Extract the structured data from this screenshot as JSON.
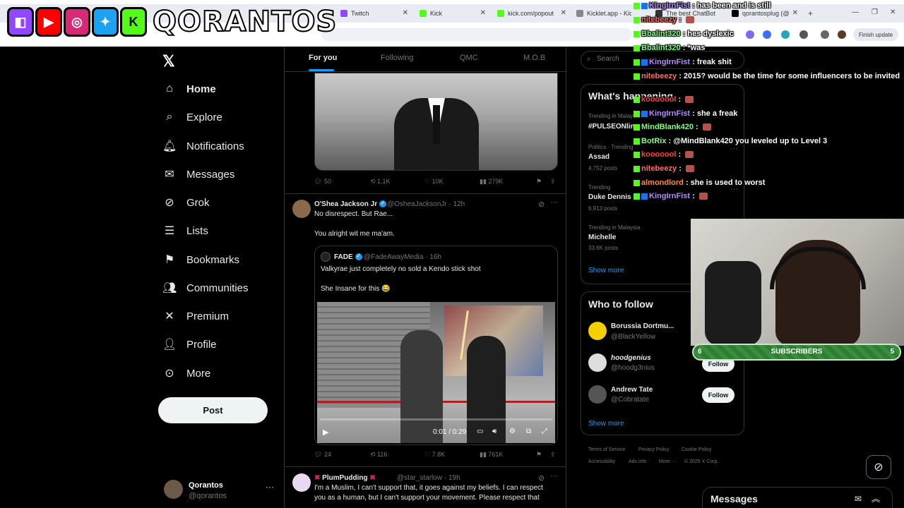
{
  "browser": {
    "tabs": [
      {
        "label": "Twitch",
        "color": "#9146ff"
      },
      {
        "label": "Kick",
        "color": "#53fc18"
      },
      {
        "label": "kick.com/popout",
        "color": "#53fc18"
      },
      {
        "label": "Kicklet.app - Kick",
        "color": "#888888"
      },
      {
        "label": "The best ChatBot",
        "color": "#333333"
      },
      {
        "label": "qorantosplug (@",
        "color": "#000000"
      }
    ],
    "finish_update": "Finish update"
  },
  "overlay": {
    "logo_text": "QORANTOS",
    "chat": [
      {
        "user": "KingIrnFist",
        "user_color": "#b38cff",
        "message": "has been and is still"
      },
      {
        "user": "nitebeezy",
        "user_color": "#ff6b6b",
        "message": ""
      },
      {
        "user": "Bbalint320",
        "user_color": "#7fff7f",
        "message": "hes dyslexic"
      },
      {
        "user": "Bbalint320",
        "user_color": "#7fff7f",
        "message": "*was"
      },
      {
        "user": "KingIrnFist",
        "user_color": "#b38cff",
        "message": "freak shit"
      },
      {
        "user": "nitebeezy",
        "user_color": "#ff6b6b",
        "message": "2015? would be the time for some influencers to be invited"
      },
      {
        "user": "kooooool",
        "user_color": "#ff4040",
        "message": ""
      },
      {
        "user": "KingIrnFist",
        "user_color": "#b38cff",
        "message": "she a freak"
      },
      {
        "user": "MindBlank420",
        "user_color": "#7fff7f",
        "message": ""
      },
      {
        "user": "BotRix",
        "user_color": "#7fff7f",
        "message": "@MindBlank420 you leveled up to Level 3"
      },
      {
        "user": "kooooool",
        "user_color": "#ff4040",
        "message": ""
      },
      {
        "user": "nitebeezy",
        "user_color": "#ff6b6b",
        "message": ""
      },
      {
        "user": "almondlord",
        "user_color": "#ff8c3a",
        "message": "she is used to worst"
      },
      {
        "user": "KingIrnFist",
        "user_color": "#b38cff",
        "message": ""
      }
    ],
    "subscribers": {
      "label": "SUBSCRIBERS",
      "current": "6",
      "goal": "5"
    }
  },
  "nav": {
    "items": [
      {
        "label": "Home",
        "icon": "home-icon"
      },
      {
        "label": "Explore",
        "icon": "search-icon"
      },
      {
        "label": "Notifications",
        "icon": "bell-icon"
      },
      {
        "label": "Messages",
        "icon": "envelope-icon"
      },
      {
        "label": "Grok",
        "icon": "grok-icon"
      },
      {
        "label": "Lists",
        "icon": "list-icon"
      },
      {
        "label": "Bookmarks",
        "icon": "bookmark-icon"
      },
      {
        "label": "Communities",
        "icon": "people-icon"
      },
      {
        "label": "Premium",
        "icon": "x-icon"
      },
      {
        "label": "Profile",
        "icon": "person-icon"
      },
      {
        "label": "More",
        "icon": "more-icon"
      }
    ],
    "post_label": "Post",
    "account": {
      "name": "Qorantos",
      "handle": "@qorantos"
    }
  },
  "feed": {
    "tabs": [
      "For you",
      "Following",
      "QMC",
      "M.O.B"
    ],
    "tweet0_actions": {
      "replies": "50",
      "reposts": "1.1K",
      "likes": "10K",
      "views": "279K"
    },
    "tweet1": {
      "name": "O'Shea Jackson Jr",
      "handle": "@OsheaJacksonJr",
      "time": "12h",
      "line1": "No disrespect. But Rae...",
      "line2": "You alright wit me ma'am.",
      "quote": {
        "name": "FADE",
        "handle": "@FadeAwayMedia",
        "time": "16h",
        "line1": "Valkyrae just completely no sold a Kendo stick shot",
        "line2": "She Insane for this 😂"
      },
      "video_time": "0:01 / 0:29",
      "actions": {
        "replies": "24",
        "reposts": "116",
        "likes": "7.8K",
        "views": "761K"
      }
    },
    "tweet2": {
      "name": "PlumPudding",
      "handle": "@star_starlow",
      "time": "19h",
      "line1": "I'm a Muslim, I can't support that, it goes against my beliefs. I can respect",
      "line2": "you as a human, but I can't support your movement. Please respect that"
    }
  },
  "sidebar": {
    "search_placeholder": "Search",
    "whats_happening": {
      "title": "What's happening",
      "trends": [
        {
          "meta": "Trending in Malaysia",
          "name": "#PULSEONline",
          "count": ""
        },
        {
          "meta": "Politics · Trending",
          "name": "Assad",
          "count": "4,752 posts"
        },
        {
          "meta": "Trending",
          "name": "Duke Dennis",
          "count": "6,913 posts"
        },
        {
          "meta": "Trending in Malaysia",
          "name": "Michelle",
          "count": "33.6K posts"
        }
      ],
      "show_more": "Show more"
    },
    "who_to_follow": {
      "title": "Who to follow",
      "accounts": [
        {
          "name": "Borussia Dortmu...",
          "handle": "@BlackYellow",
          "avatar_color": "#f5d000"
        },
        {
          "name": "hoodgenius",
          "handle": "@hoodg3nius",
          "avatar_color": "#dddddd"
        },
        {
          "name": "Andrew Tate",
          "handle": "@Cobratate",
          "avatar_color": "#555555"
        }
      ],
      "follow_label": "Follow",
      "show_more": "Show more"
    },
    "footer": [
      "Terms of Service",
      "Privacy Policy",
      "Cookie Policy",
      "Accessibility",
      "Ads info",
      "More ···",
      "© 2025 X Corp."
    ]
  },
  "messages_drawer": {
    "title": "Messages"
  }
}
